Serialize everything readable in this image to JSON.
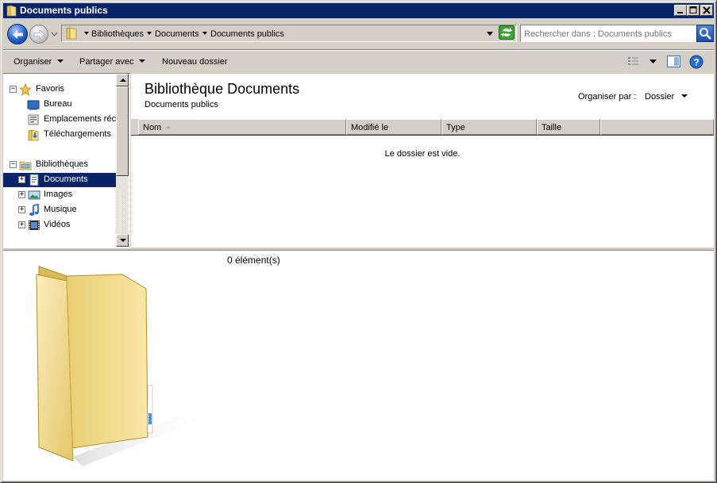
{
  "window": {
    "title": "Documents publics",
    "controls": {
      "minimize": "_",
      "maximize": "□",
      "close": "×"
    }
  },
  "nav": {
    "breadcrumbs": [
      "Bibliothèques",
      "Documents",
      "Documents publics"
    ],
    "search_placeholder": "Rechercher dans : Documents publics"
  },
  "commandbar": {
    "organize": "Organiser",
    "share": "Partager avec",
    "new_folder": "Nouveau dossier"
  },
  "navpane": {
    "favorites": {
      "label": "Favoris",
      "items": [
        "Bureau",
        "Emplacements récents",
        "Téléchargements"
      ]
    },
    "libraries": {
      "label": "Bibliothèques",
      "items": [
        "Documents",
        "Images",
        "Musique",
        "Vidéos"
      ],
      "selected": "Documents"
    }
  },
  "content": {
    "library_title": "Bibliothèque Documents",
    "library_subtitle": "Documents publics",
    "arrange_label": "Organiser par :",
    "arrange_value": "Dossier",
    "columns": [
      "Nom",
      "Modifié le",
      "Type",
      "Taille"
    ],
    "empty_message": "Le dossier est vide."
  },
  "details": {
    "item_count": "0 élément(s)"
  },
  "colors": {
    "titlebar": "#0a246a",
    "chrome": "#d4d0c8",
    "selection": "#0a246a",
    "folder": "#f3d98a"
  }
}
